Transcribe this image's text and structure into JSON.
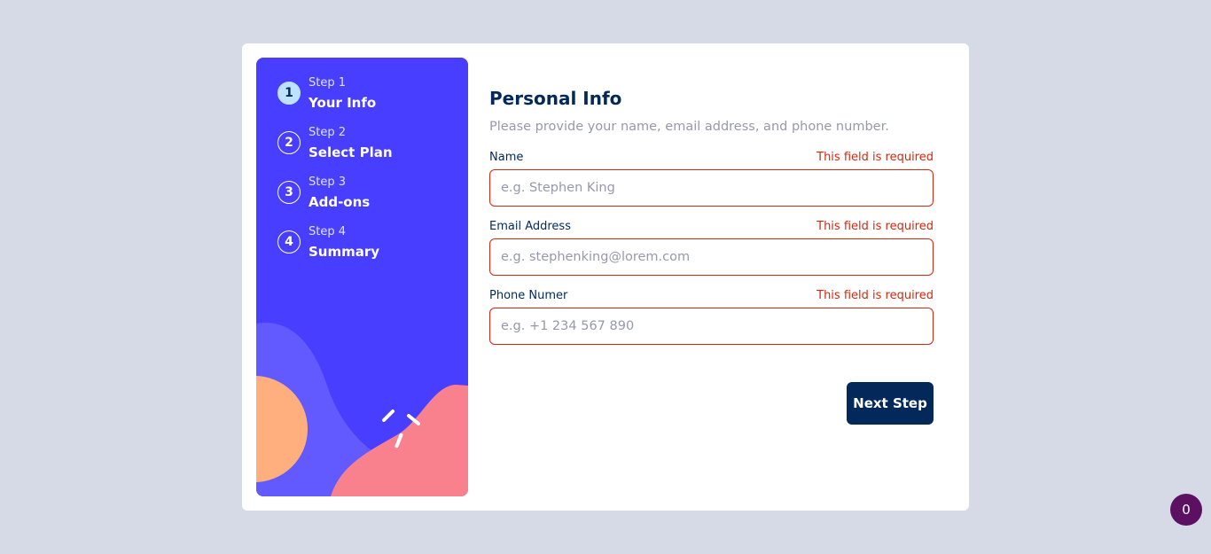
{
  "sidebar": {
    "steps": [
      {
        "number": "1",
        "label": "Step 1",
        "title": "Your Info",
        "active": true
      },
      {
        "number": "2",
        "label": "Step 2",
        "title": "Select Plan",
        "active": false
      },
      {
        "number": "3",
        "label": "Step 3",
        "title": "Add-ons",
        "active": false
      },
      {
        "number": "4",
        "label": "Step 4",
        "title": "Summary",
        "active": false
      }
    ]
  },
  "form": {
    "title": "Personal Info",
    "subtitle": "Please provide your name, email address, and phone number.",
    "fields": [
      {
        "label": "Name",
        "error": "This field is required",
        "placeholder": "e.g. Stephen King",
        "value": ""
      },
      {
        "label": "Email Address",
        "error": "This field is required",
        "placeholder": "e.g. stephenking@lorem.com",
        "value": ""
      },
      {
        "label": "Phone Numer",
        "error": "This field is required",
        "placeholder": "e.g. +1 234 567 890",
        "value": ""
      }
    ],
    "next_label": "Next Step"
  },
  "badge": {
    "count": "0"
  },
  "colors": {
    "page_bg": "#d6d9e6",
    "sidebar_bg": "#483eff",
    "active_step": "#bee2fd",
    "primary_text": "#02295a",
    "error": "#d6270d",
    "muted": "#9699ab",
    "badge": "#5c1062"
  }
}
